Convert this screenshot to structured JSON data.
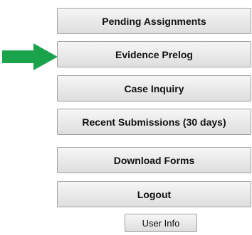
{
  "menu": {
    "pending_assignments": "Pending Assignments",
    "evidence_prelog": "Evidence Prelog",
    "case_inquiry": "Case Inquiry",
    "recent_submissions": "Recent Submissions (30 days)",
    "download_forms": "Download Forms",
    "logout": "Logout"
  },
  "user_info": "User Info",
  "annotation": {
    "icon": "green-arrow-icon",
    "points_to": "Evidence Prelog",
    "color": "#1aa34a"
  },
  "colors": {
    "button_border": "#a0a0a0",
    "button_text": "#111111"
  }
}
